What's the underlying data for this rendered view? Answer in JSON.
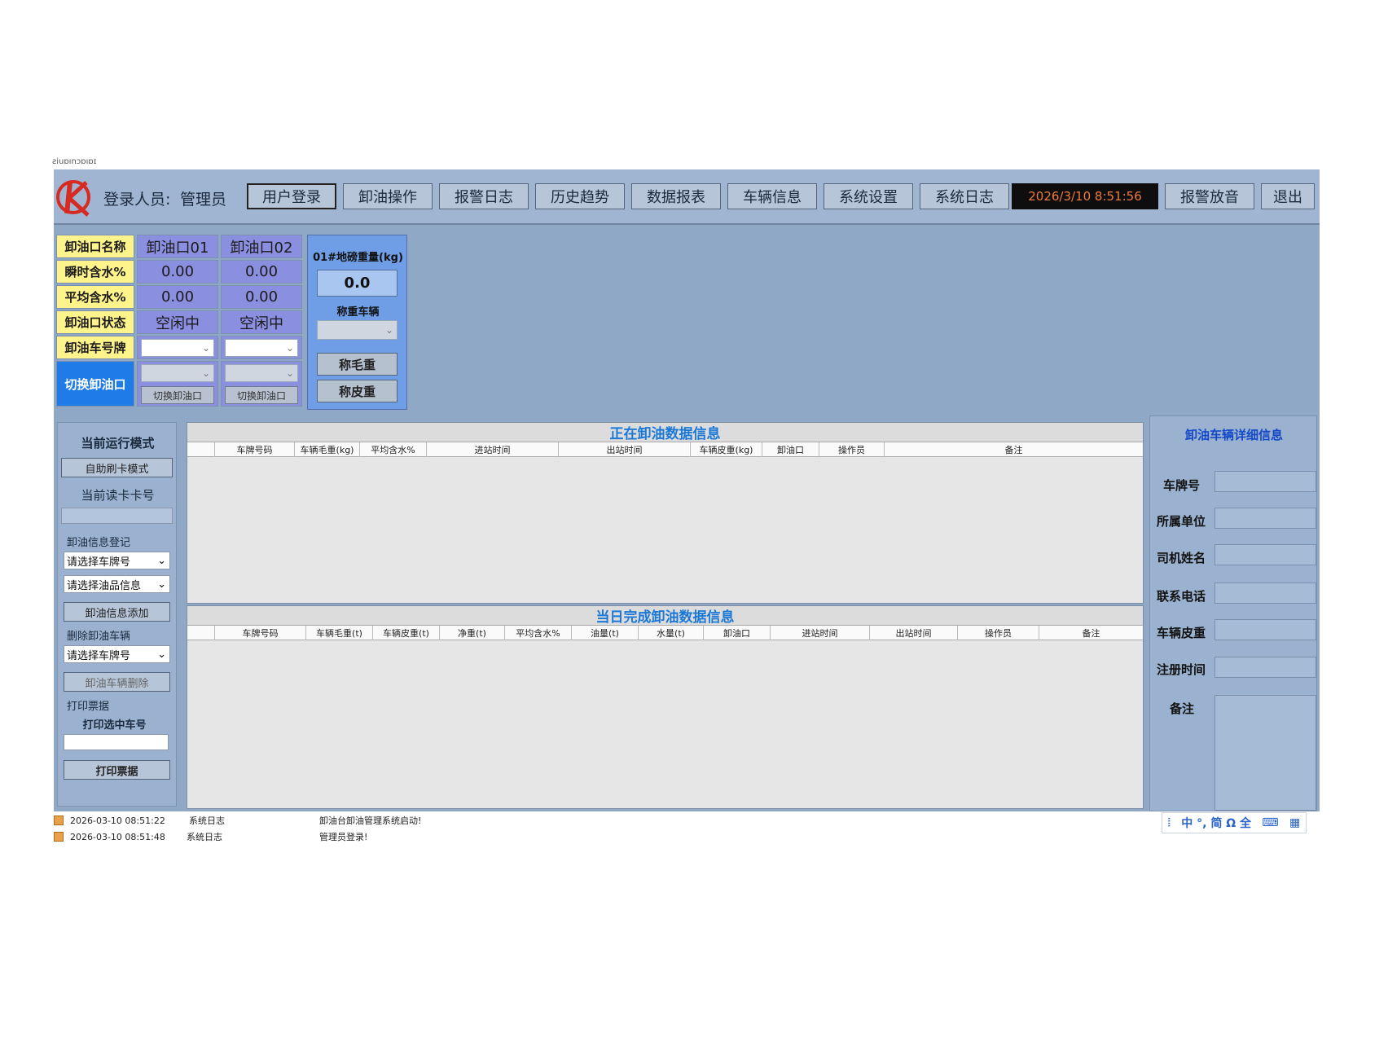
{
  "window": {
    "caption": "ƨiuɒınɔɒıɒɪ"
  },
  "header": {
    "login_label": "登录人员:",
    "login_user": "管理员",
    "nav": [
      "用户登录",
      "卸油操作",
      "报警日志",
      "历史趋势",
      "数据报表",
      "车辆信息",
      "系统设置",
      "系统日志"
    ],
    "datetime": "2026/3/10 8:51:56",
    "alarm_mute": "报警放音",
    "exit": "退出"
  },
  "ports": {
    "labels": [
      "卸油口名称",
      "瞬时含水%",
      "平均含水%",
      "卸油口状态",
      "卸油车号牌",
      "切换卸油口"
    ],
    "port1": {
      "name": "卸油口01",
      "instant": "0.00",
      "average": "0.00",
      "status": "空闲中"
    },
    "port2": {
      "name": "卸油口02",
      "instant": "0.00",
      "average": "0.00",
      "status": "空闲中"
    },
    "switch_button": "切换卸油口"
  },
  "weigh": {
    "title": "01#地磅重量(kg)",
    "value": "0.0",
    "subtitle": "称重车辆",
    "gross_button": "称毛重",
    "tare_button": "称皮重"
  },
  "left_panel": {
    "title": "当前运行模式",
    "mode_button": "自助刷卡模式",
    "card_label": "当前读卡卡号",
    "register_group": "卸油信息登记",
    "select_plate": "请选择车牌号",
    "select_oil": "请选择油品信息",
    "add_button": "卸油信息添加",
    "delete_group": "删除卸油车辆",
    "select_plate2": "请选择车牌号",
    "delete_button": "卸油车辆删除",
    "print_group": "打印票据",
    "print_label": "打印选中车号",
    "print_button": "打印票据"
  },
  "grid1": {
    "title": "正在卸油数据信息",
    "columns": [
      "车牌号码",
      "车辆毛重(kg)",
      "平均含水%",
      "进站时间",
      "出站时间",
      "车辆皮重(kg)",
      "卸油口",
      "操作员",
      "备注"
    ]
  },
  "grid2": {
    "title": "当日完成卸油数据信息",
    "columns": [
      "车牌号码",
      "车辆毛重(t)",
      "车辆皮重(t)",
      "净重(t)",
      "平均含水%",
      "油量(t)",
      "水量(t)",
      "卸油口",
      "进站时间",
      "出站时间",
      "操作员",
      "备注"
    ]
  },
  "right_panel": {
    "title": "卸油车辆详细信息",
    "fields": [
      "车牌号",
      "所属单位",
      "司机姓名",
      "联系电话",
      "车辆皮重",
      "注册时间",
      "备注"
    ]
  },
  "log": [
    {
      "time": "2026-03-10 08:51:22",
      "type": "系统日志",
      "msg": "卸油台卸油管理系统启动!"
    },
    {
      "time": "2026-03-10 08:51:48",
      "type": "系统日志",
      "msg": "管理员登录!"
    }
  ],
  "ime_bar": "中 °, 简 Ω 全",
  "colors": {
    "accent_blue": "#1c78d6",
    "label_yellow": "#fff38c",
    "port_purple": "#8b8fe0",
    "clock_orange": "#f07a3c"
  }
}
